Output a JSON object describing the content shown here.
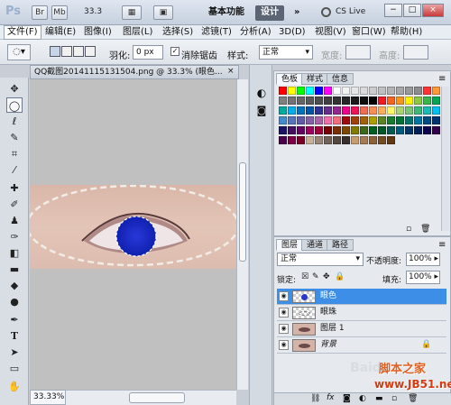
{
  "titlebar": {
    "app": "Ps",
    "zoom": "33.3",
    "workspace": "基本功能",
    "design": "设计",
    "more": "»",
    "cslive": "CS Live"
  },
  "menus": [
    "文件(F)",
    "编辑(E)",
    "图像(I)",
    "图层(L)",
    "选择(S)",
    "滤镜(T)",
    "分析(A)",
    "3D(D)",
    "视图(V)",
    "窗口(W)",
    "帮助(H)"
  ],
  "options": {
    "feather_label": "羽化:",
    "feather_value": "0 px",
    "antialias_label": "消除锯齿",
    "style_label": "样式:",
    "style_value": "正常",
    "width_label": "宽度:",
    "height_label": "高度:"
  },
  "document": {
    "tab": "QQ截图20141115131504.png @ 33.3% (眼色...",
    "close": "×",
    "zoom": "33.33%"
  },
  "swatch_panel": {
    "tabs": [
      "色板",
      "样式",
      "信息"
    ],
    "colors": [
      "#ff0000",
      "#ffff00",
      "#00ff00",
      "#00ffff",
      "#0000ff",
      "#ff00ff",
      "#ffffff",
      "#f2f2f2",
      "#e6e6e6",
      "#d9d9d9",
      "#cccccc",
      "#bfbfbf",
      "#b3b3b3",
      "#a6a6a6",
      "#999999",
      "#8c8c8c",
      "#ff3333",
      "#ff9933",
      "#808080",
      "#737373",
      "#666666",
      "#595959",
      "#4d4d4d",
      "#404040",
      "#333333",
      "#262626",
      "#1a1a1a",
      "#0d0d0d",
      "#000000",
      "#ed1c24",
      "#f26522",
      "#f7941d",
      "#fff200",
      "#8dc63f",
      "#39b54a",
      "#00a651",
      "#00a99d",
      "#00aeef",
      "#0072bc",
      "#0054a6",
      "#2e3192",
      "#662d91",
      "#92278f",
      "#ec008c",
      "#ed145b",
      "#f26c4f",
      "#f68e56",
      "#fbaf5d",
      "#fff568",
      "#acd373",
      "#7cc576",
      "#3cb878",
      "#1abbb4",
      "#00bff3",
      "#448ccb",
      "#5674b9",
      "#605ca8",
      "#8560a8",
      "#a864a8",
      "#f06eaa",
      "#f26d7d",
      "#9e0b0f",
      "#a0410d",
      "#a36209",
      "#aba000",
      "#598527",
      "#197b30",
      "#007236",
      "#00746b",
      "#0076a3",
      "#004a80",
      "#003471",
      "#1b1464",
      "#440e62",
      "#630460",
      "#9e005d",
      "#9e0039",
      "#790000",
      "#7b2e00",
      "#7d4900",
      "#827b00",
      "#406618",
      "#005e20",
      "#005826",
      "#005952",
      "#005b7f",
      "#003663",
      "#002157",
      "#0d004c",
      "#32004b",
      "#4b0049",
      "#7b0046",
      "#7a0026",
      "#c7b299",
      "#998675",
      "#736357",
      "#534741",
      "#37302a",
      "#c69c6d",
      "#a67c52",
      "#8c6239",
      "#754c24",
      "#603913"
    ]
  },
  "layers_panel": {
    "tabs": [
      "图层",
      "通道",
      "路径"
    ],
    "blend_mode": "正常",
    "opacity_label": "不透明度:",
    "opacity_value": "100%",
    "lock_label": "锁定:",
    "fill_label": "填充:",
    "fill_value": "100%",
    "layers": [
      {
        "name": "眼色",
        "selected": true
      },
      {
        "name": "眼珠",
        "selected": false
      },
      {
        "name": "图层 1",
        "selected": false
      },
      {
        "name": "背景",
        "selected": false
      }
    ]
  },
  "watermark": {
    "baidu": "Baidu",
    "site_name": "脚本之家",
    "site_url": "www.JB51.net"
  }
}
